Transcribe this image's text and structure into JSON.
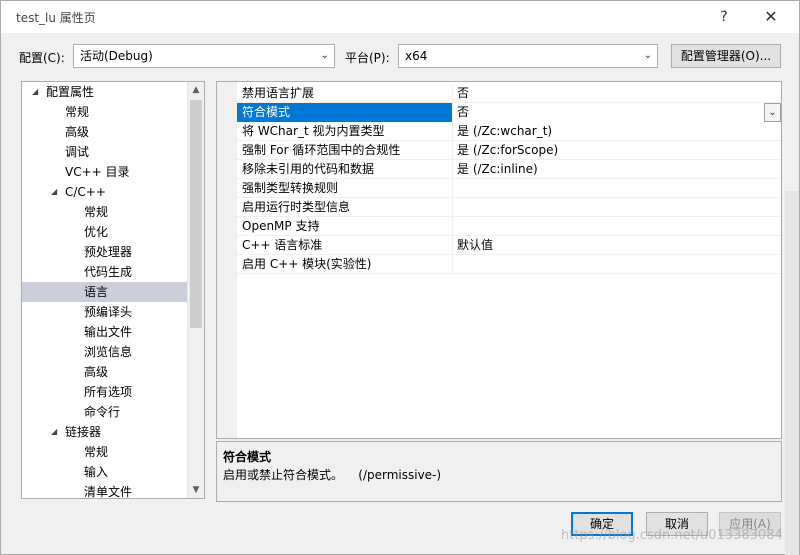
{
  "window": {
    "title": "test_lu 属性页",
    "help_label": "?",
    "close_label": "✕"
  },
  "toolbar": {
    "config_label": "配置(C):",
    "config_value": "活动(Debug)",
    "platform_label": "平台(P):",
    "platform_value": "x64",
    "config_manager_label": "配置管理器(O)..."
  },
  "tree": {
    "items": [
      {
        "label": "配置属性",
        "expanded": true
      },
      {
        "label": "常规"
      },
      {
        "label": "高级"
      },
      {
        "label": "调试"
      },
      {
        "label": "VC++ 目录"
      },
      {
        "label": "C/C++",
        "expanded": true
      },
      {
        "label": "常规"
      },
      {
        "label": "优化"
      },
      {
        "label": "预处理器"
      },
      {
        "label": "代码生成"
      },
      {
        "label": "语言",
        "selected": true
      },
      {
        "label": "预编译头"
      },
      {
        "label": "输出文件"
      },
      {
        "label": "浏览信息"
      },
      {
        "label": "高级"
      },
      {
        "label": "所有选项"
      },
      {
        "label": "命令行"
      },
      {
        "label": "链接器",
        "expanded": true
      },
      {
        "label": "常规"
      },
      {
        "label": "输入"
      },
      {
        "label": "清单文件"
      }
    ]
  },
  "properties": {
    "rows": [
      {
        "name": "禁用语言扩展",
        "value": "否"
      },
      {
        "name": "符合模式",
        "value": "否",
        "selected": true
      },
      {
        "name": "将 WChar_t 视为内置类型",
        "value": "是 (/Zc:wchar_t)"
      },
      {
        "name": "强制 For 循环范围中的合规性",
        "value": "是 (/Zc:forScope)"
      },
      {
        "name": "移除未引用的代码和数据",
        "value": "是 (/Zc:inline)"
      },
      {
        "name": "强制类型转换规则",
        "value": ""
      },
      {
        "name": "启用运行时类型信息",
        "value": ""
      },
      {
        "name": "OpenMP 支持",
        "value": ""
      },
      {
        "name": "C++ 语言标准",
        "value": "默认值"
      },
      {
        "name": "启用 C++ 模块(实验性)",
        "value": ""
      }
    ]
  },
  "description": {
    "title": "符合模式",
    "text": "启用或禁止符合模式。    (/permissive-)"
  },
  "buttons": {
    "ok": "确定",
    "cancel": "取消",
    "apply": "应用(A)"
  },
  "watermark": "https://blog.csdn.net/u013383084",
  "colors": {
    "selection_blue": "#0078d7",
    "tree_selected": "#cccedb"
  }
}
